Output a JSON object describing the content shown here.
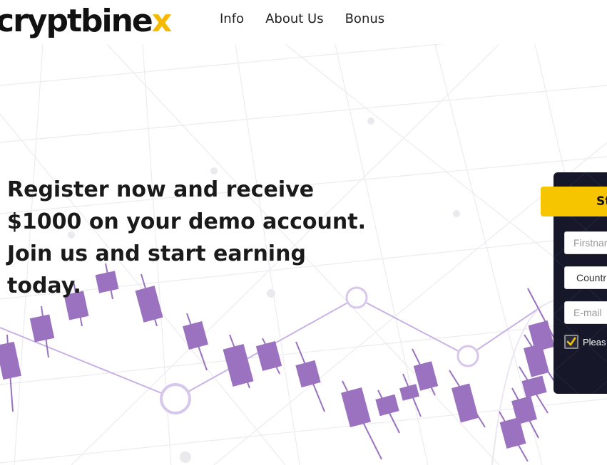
{
  "header": {
    "logo_main": "cryptbine",
    "logo_accent": "x",
    "nav": [
      {
        "label": "Info"
      },
      {
        "label": "About Us"
      },
      {
        "label": "Bonus"
      }
    ]
  },
  "hero": {
    "headline": "Register now and receive $1000 on your demo account. Join us and start earning today."
  },
  "form": {
    "button_label": "St",
    "firstname_placeholder": "Firstnar",
    "country_value": "Countr",
    "email_placeholder": "E-mail",
    "consent_label": "Pleas",
    "consent_checked": true
  },
  "colors": {
    "accent": "#f7c400",
    "candle": "#9a72bf",
    "panel": "#16182a"
  }
}
